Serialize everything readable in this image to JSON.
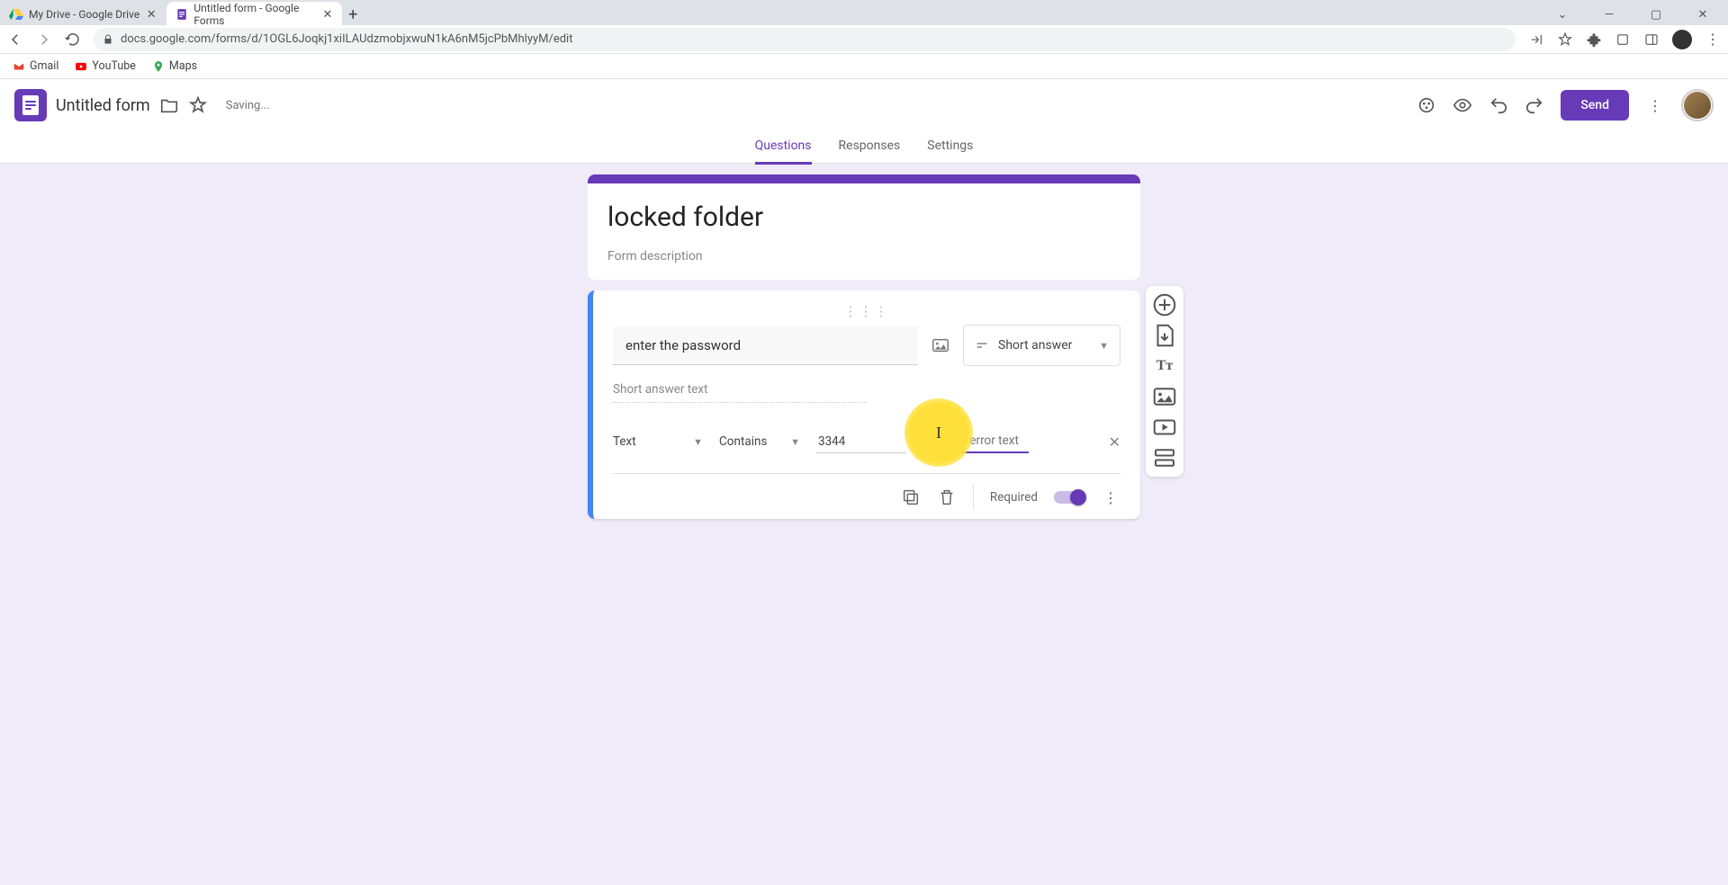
{
  "browser": {
    "tabs": [
      {
        "title": "My Drive - Google Drive",
        "active": false
      },
      {
        "title": "Untitled form - Google Forms",
        "active": true
      }
    ],
    "url": "docs.google.com/forms/d/1OGL6Joqkj1xiILAUdzmobjxwuN1kA6nM5jcPbMhlyyM/edit",
    "bookmarks": [
      "Gmail",
      "YouTube",
      "Maps"
    ]
  },
  "header": {
    "form_name": "Untitled form",
    "status": "Saving...",
    "send_label": "Send"
  },
  "nav_tabs": {
    "questions": "Questions",
    "responses": "Responses",
    "settings": "Settings"
  },
  "form": {
    "title": "locked folder",
    "description_placeholder": "Form description"
  },
  "question": {
    "text": "enter the password",
    "type_label": "Short answer",
    "short_answer_placeholder": "Short answer text",
    "validation": {
      "type": "Text",
      "condition": "Contains",
      "pattern": "3344",
      "error_placeholder": "Custom error text"
    },
    "required_label": "Required",
    "required_on": true
  },
  "side_toolbar_labels": [
    "add-question",
    "import-questions",
    "add-title",
    "add-image",
    "add-video",
    "add-section"
  ]
}
